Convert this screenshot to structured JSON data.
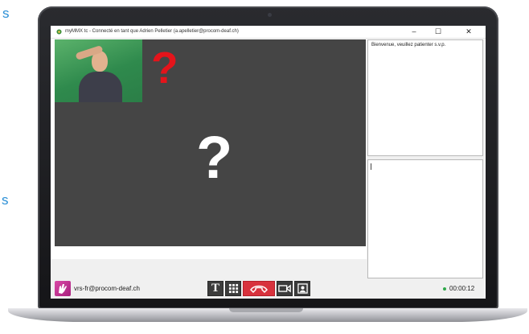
{
  "edge_text": {
    "top": "s",
    "middle": "s"
  },
  "window": {
    "title": "myMMX tc - Connecté en tant que Adrien Pelletier (a.apelletier@procom-deaf.ch)",
    "controls": {
      "minimize": "–",
      "maximize": "☐",
      "close": "✕"
    }
  },
  "video": {
    "remote_placeholder": "?",
    "self_placeholder": "?"
  },
  "chat": {
    "received_text": "Bienvenue, veuillez patienter s.v.p.",
    "input_value": ""
  },
  "status_bar": {
    "account": "vrs-fr@procom-deaf.ch",
    "call_timer": "00:00:12"
  },
  "toolbar": {
    "text_button_label": "T",
    "icons": [
      "text-icon",
      "keypad-icon",
      "hangup-icon",
      "camera-icon",
      "self-view-icon"
    ]
  },
  "colors": {
    "accent_red": "#e4141b",
    "hangup_red": "#d8323d",
    "status_green": "#2ea84a",
    "brand_pink": "#d94aa6"
  }
}
